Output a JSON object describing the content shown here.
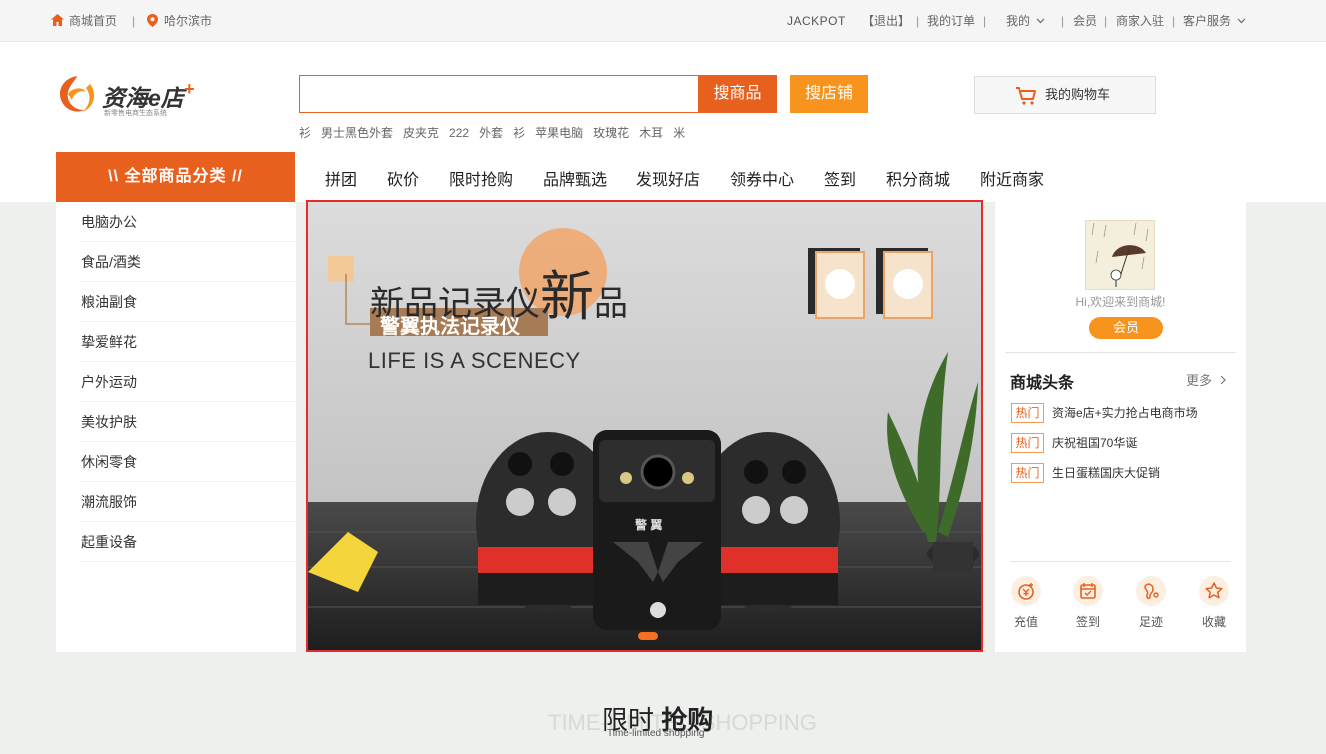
{
  "topbar": {
    "home": "商城首页",
    "city": "哈尔滨市",
    "username": "JACKPOT",
    "logout": "【退出】",
    "orders": "我的订单",
    "mine": "我的",
    "member": "会员",
    "merchant": "商家入驻",
    "service": "客户服务",
    "sep": "|"
  },
  "logo": {
    "name": "资海e店",
    "plus": "+",
    "slogan": "新零售电商生态系统"
  },
  "search": {
    "value": "",
    "goods_button": "搜商品",
    "shop_button": "搜店铺"
  },
  "cart": {
    "label": "我的购物车"
  },
  "hotwords": [
    "衫",
    "男士黑色外套",
    "皮夹克",
    "222",
    "外套",
    "衫",
    "苹果电脑",
    "玫瑰花",
    "木耳",
    "米"
  ],
  "all_categories": "\\\\ 全部商品分类 //",
  "nav": [
    "拼团",
    "砍价",
    "限时抢购",
    "品牌甄选",
    "发现好店",
    "领券中心",
    "签到",
    "积分商城",
    "附近商家"
  ],
  "categories": [
    "电脑办公",
    "食品/酒类",
    "粮油副食",
    "挚爱鲜花",
    "户外运动",
    "美妆护肤",
    "休闲零食",
    "潮流服饰",
    "起重设备"
  ],
  "banner": {
    "headline_a": "新品记录仪",
    "headline_big": "新",
    "headline_b": "品",
    "tag": "警翼执法记录仪",
    "slogan": "LIFE IS A SCENECY",
    "device_brand": "警 翼"
  },
  "user_panel": {
    "welcome": "Hi,欢迎来到商城!",
    "member_button": "会员",
    "news_title": "商城头条",
    "more": "更多",
    "news": [
      {
        "badge": "热门",
        "text": "资海e店+实力抢占电商市场"
      },
      {
        "badge": "热门",
        "text": "庆祝祖国70华诞"
      },
      {
        "badge": "热门",
        "text": "生日蛋糕国庆大促销"
      }
    ],
    "actions": [
      {
        "label": "充值",
        "icon": "recharge-icon"
      },
      {
        "label": "签到",
        "icon": "calendar-check-icon"
      },
      {
        "label": "足迹",
        "icon": "footprint-icon"
      },
      {
        "label": "收藏",
        "icon": "star-icon"
      }
    ]
  },
  "flash_sale": {
    "bg_text": "TIME-LIMITED SHOPPING",
    "title_a": "限时",
    "title_b": "抢购",
    "subtitle": "Time-limited shopping"
  },
  "colors": {
    "brand_orange": "#e8601e",
    "accent_orange": "#f7941d",
    "banner_border": "#e52b2b"
  }
}
